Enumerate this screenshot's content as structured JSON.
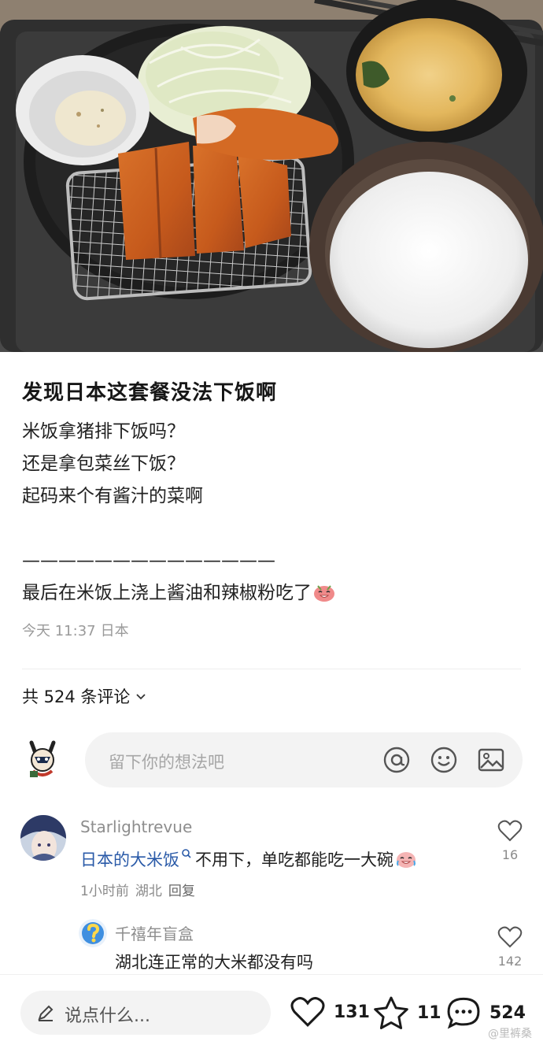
{
  "post": {
    "title": "发现日本这套餐没法下饭啊",
    "lines": [
      "米饭拿猪排下饭吗？",
      "还是拿包菜丝下饭？",
      "起码来个有酱汁的菜啊"
    ],
    "separator": "——————————————",
    "last_line": "最后在米饭上浇上酱油和辣椒粉吃了",
    "time": "今天 11:37",
    "location": "日本"
  },
  "comments_header": {
    "label": "共 524 条评论"
  },
  "comment_input": {
    "placeholder": "留下你的想法吧"
  },
  "comments": [
    {
      "user": "Starlightrevue",
      "keyword": "日本的大米饭",
      "text": "不用下，单吃都能吃一大碗",
      "time": "1小时前",
      "location": "湖北",
      "reply": "回复",
      "likes": "16"
    },
    {
      "user": "千禧年盲盒",
      "text": "湖北连正常的大米都没有吗",
      "likes": "142"
    }
  ],
  "bottom_bar": {
    "placeholder": "说点什么...",
    "likes": "131",
    "favorites": "11",
    "comments": "524",
    "watermark": "@里裤桑"
  },
  "icons": {
    "comment_input": [
      "at-icon",
      "smiley-icon",
      "image-icon"
    ],
    "bottom": [
      "heart-icon",
      "star-icon",
      "comment-bubble-icon"
    ]
  }
}
